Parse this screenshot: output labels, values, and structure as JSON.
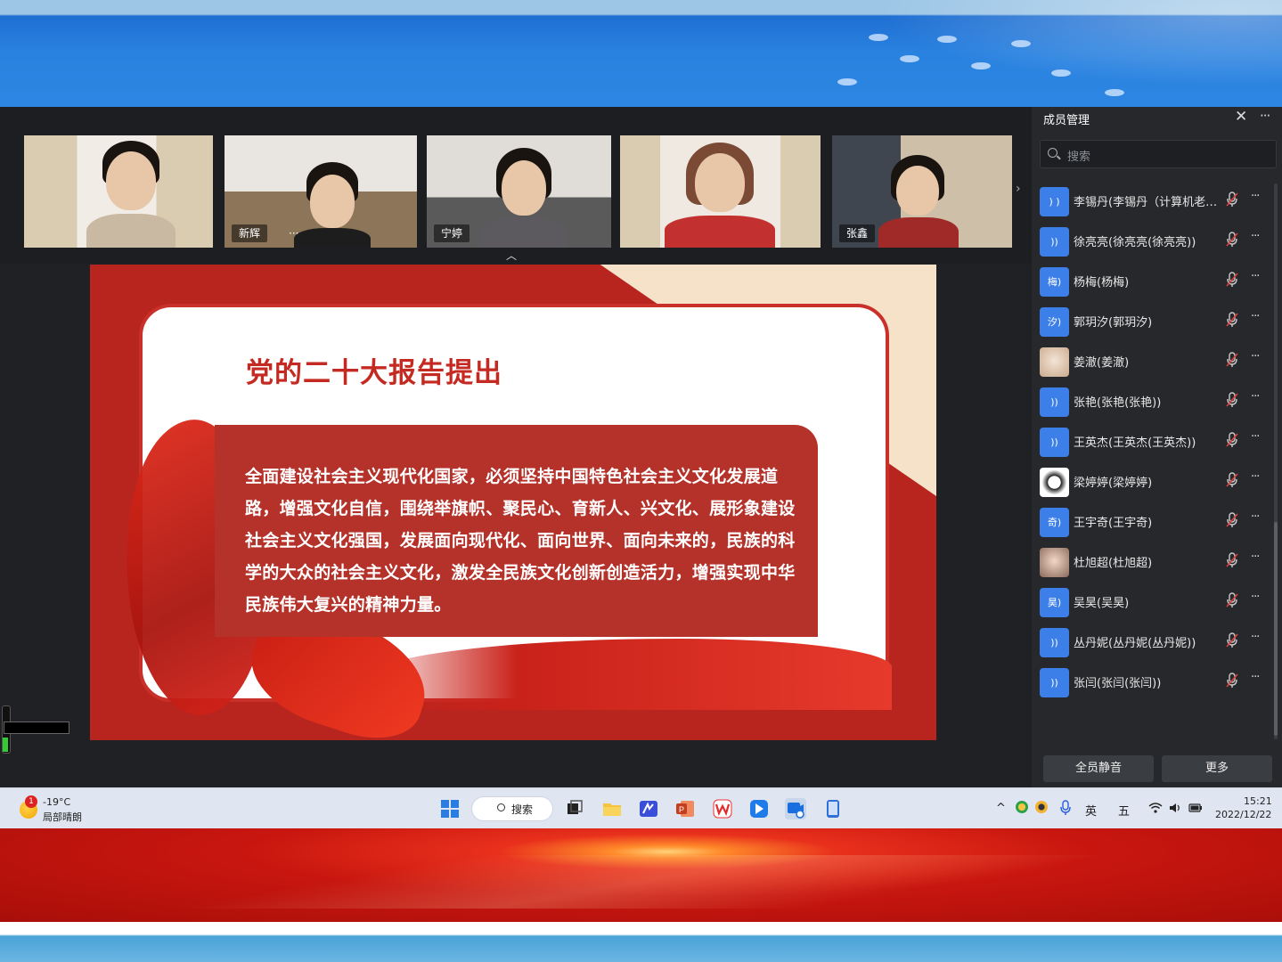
{
  "video_strip": {
    "tiles": [
      {
        "name": ""
      },
      {
        "name": "新辉",
        "more": "···"
      },
      {
        "name": "宁婷"
      },
      {
        "name": ""
      },
      {
        "name": "张鑫"
      }
    ],
    "next_glyph": "›",
    "collapse_glyph": "︿"
  },
  "slide": {
    "title": "党的二十大报告提出",
    "body": "全面建设社会主义现代化国家，必须坚持中国特色社会主义文化发展道路，增强文化自信，围绕举旗帜、聚民心、育新人、兴文化、展形象建设社会主义文化强国，发展面向现代化、面向世界、面向未来的，民族的科学的大众的社会主义文化，激发全民族文化创新创造活力，增强实现中华民族伟大复兴的精神力量。"
  },
  "panel": {
    "title": "成员管理",
    "close_glyph": "✕",
    "more_glyph": "···",
    "search_placeholder": "搜索",
    "members": [
      {
        "avatar_text": ") )",
        "name": "李锡丹(李锡丹（计算机老师..."
      },
      {
        "avatar_text": "))",
        "name": "徐亮亮(徐亮亮(徐亮亮))"
      },
      {
        "avatar_text": "梅)",
        "name": "杨梅(杨梅)"
      },
      {
        "avatar_text": "汐)",
        "name": "郭玥汐(郭玥汐)"
      },
      {
        "avatar_text": "",
        "name": "姜澈(姜澈)"
      },
      {
        "avatar_text": "))",
        "name": "张艳(张艳(张艳))"
      },
      {
        "avatar_text": "))",
        "name": "王英杰(王英杰(王英杰))"
      },
      {
        "avatar_text": "",
        "name": "梁婷婷(梁婷婷)"
      },
      {
        "avatar_text": "奇)",
        "name": "王宇奇(王宇奇)"
      },
      {
        "avatar_text": "",
        "name": "杜旭超(杜旭超)"
      },
      {
        "avatar_text": "昊)",
        "name": "吴昊(吴昊)"
      },
      {
        "avatar_text": "))",
        "name": "丛丹妮(丛丹妮(丛丹妮))"
      },
      {
        "avatar_text": "))",
        "name": "张闫(张闫(张闫))"
      }
    ],
    "row_more_glyph": "···",
    "mute_all": "全员静音",
    "more": "更多"
  },
  "taskbar": {
    "weather_badge": "1",
    "weather_temp": "-19°C",
    "weather_cond": "局部晴朗",
    "search_label": "搜索",
    "tray_chevron": "^",
    "ime_lang": "英",
    "ime_mode": "五",
    "time": "15:21",
    "date": "2022/12/22"
  },
  "colors": {
    "slide_red": "#b8251e",
    "panel_bg": "#26282b",
    "avatar_blue": "#3d7fe8",
    "taskbar_bg": "#dfe6f1"
  }
}
